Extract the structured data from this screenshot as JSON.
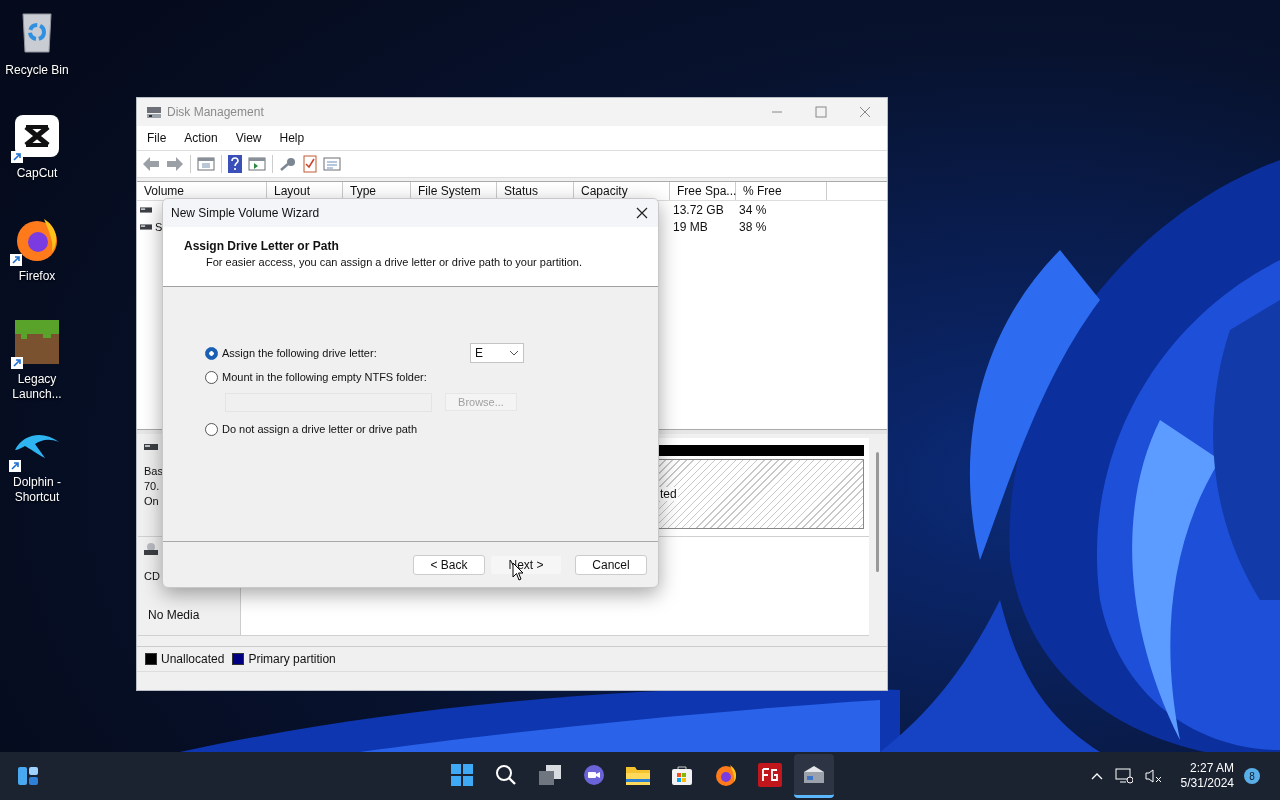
{
  "desktop_icons": [
    {
      "kind": "recycle-bin",
      "label": "Recycle Bin",
      "shortcut": false
    },
    {
      "kind": "capcut",
      "label": "CapCut",
      "shortcut": true
    },
    {
      "kind": "firefox",
      "label": "Firefox",
      "shortcut": true
    },
    {
      "kind": "grass-block",
      "label": "Legacy Launch...",
      "shortcut": true
    },
    {
      "kind": "dolphin",
      "label": "Dolphin - Shortcut",
      "shortcut": true
    }
  ],
  "window": {
    "title": "Disk Management",
    "menu": [
      "File",
      "Action",
      "View",
      "Help"
    ],
    "table": {
      "columns": [
        "Volume",
        "Layout",
        "Type",
        "File System",
        "Status",
        "Capacity",
        "Free Spa...",
        "% Free"
      ],
      "rows": [
        {
          "free_space": "13.72 GB",
          "percent_free": "34 %"
        },
        {
          "volume": "S",
          "free_space": "19 MB",
          "percent_free": "38 %"
        }
      ]
    },
    "disks": [
      {
        "kind": "disk",
        "label_lines": [
          "Bas",
          "70.",
          "On"
        ],
        "partition": {
          "label": "ted",
          "color": "#000000"
        }
      },
      {
        "kind": "cdrom",
        "label_lines": [
          "CD"
        ],
        "status": "No Media"
      }
    ],
    "legend": [
      {
        "label": "Unallocated",
        "color": "#000000"
      },
      {
        "label": "Primary partition",
        "color": "#000080"
      }
    ]
  },
  "dialog": {
    "title": "New Simple Volume Wizard",
    "heading": "Assign Drive Letter or Path",
    "subheading": "For easier access, you can assign a drive letter or drive path to your partition.",
    "options": [
      {
        "kind": "letter",
        "label": "Assign the following drive letter:",
        "selected": true
      },
      {
        "kind": "folder",
        "label": "Mount in the following empty NTFS folder:",
        "selected": false
      },
      {
        "kind": "none",
        "label": "Do not assign a drive letter or drive path",
        "selected": false
      }
    ],
    "drive_letter": "E",
    "folder_path": {
      "disabled": true
    },
    "browse": {
      "label": "Browse...",
      "disabled": true
    },
    "buttons": [
      {
        "label": "< Back",
        "kind": "normal"
      },
      {
        "label": "Next >",
        "kind": "hover"
      },
      {
        "label": "Cancel",
        "kind": "normal"
      }
    ]
  },
  "taskbar": {
    "apps": [
      {
        "kind": "start",
        "active": false
      },
      {
        "kind": "search",
        "active": false
      },
      {
        "kind": "task-view",
        "active": false
      },
      {
        "kind": "chat",
        "active": false
      },
      {
        "kind": "folder",
        "active": false
      },
      {
        "kind": "store",
        "active": false
      },
      {
        "kind": "firefox",
        "active": false
      },
      {
        "kind": "fg",
        "active": false
      },
      {
        "kind": "disk-management",
        "active": true
      }
    ],
    "time": "2:27 AM",
    "date": "5/31/2024",
    "notifications": "8"
  }
}
